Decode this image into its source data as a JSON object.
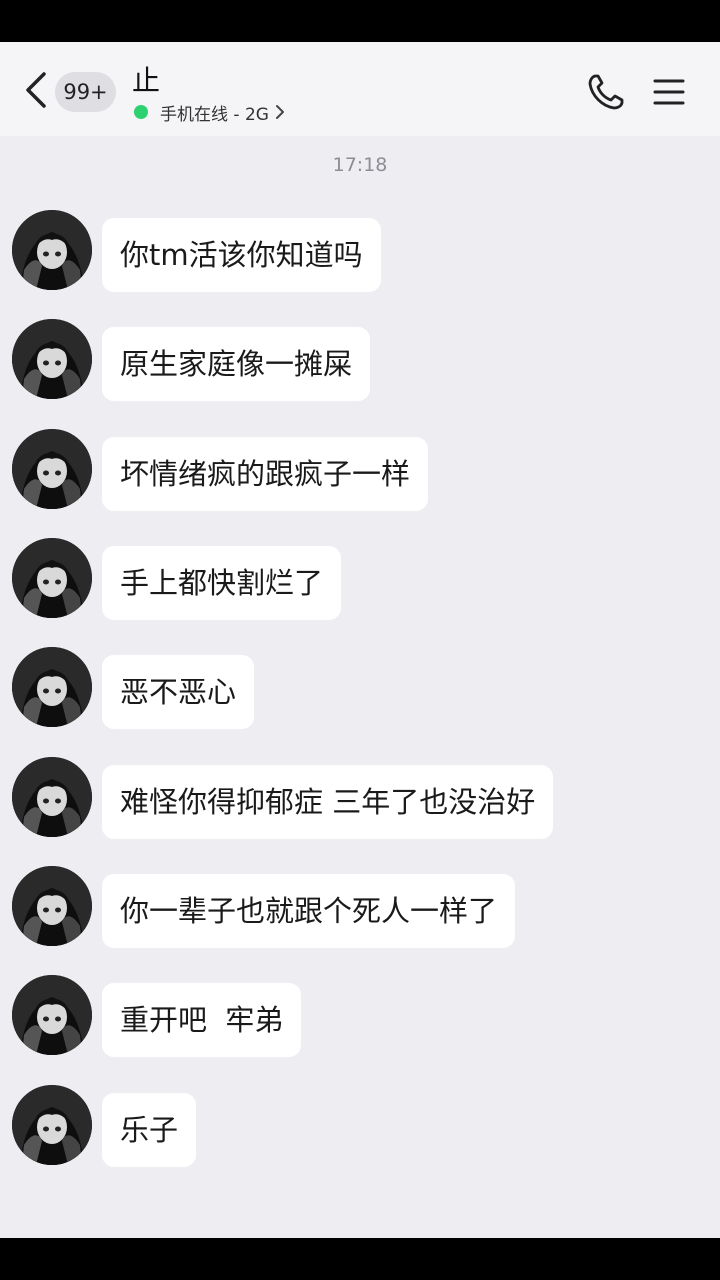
{
  "header": {
    "unread_badge": "99+",
    "contact_name": "止",
    "status_text": "手机在线 - 2G",
    "back_icon": "chevron-left-icon",
    "call_icon": "phone-icon",
    "menu_icon": "hamburger-menu-icon",
    "online_color": "#2dd170"
  },
  "timestamp": "17:18",
  "messages": [
    {
      "text": "你tm活该你知道吗"
    },
    {
      "text": "原生家庭像一摊屎"
    },
    {
      "text": "坏情绪疯的跟疯子一样"
    },
    {
      "text": "手上都快割烂了"
    },
    {
      "text": "恶不恶心"
    },
    {
      "text": "难怪你得抑郁症 三年了也没治好"
    },
    {
      "text": "你一辈子也就跟个死人一样了"
    },
    {
      "text": "重开吧  牢弟"
    },
    {
      "text": "乐子"
    }
  ]
}
